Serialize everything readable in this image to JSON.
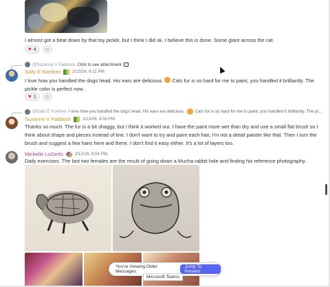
{
  "messages": [
    {
      "text": "I almost got a beat down by that toy pickle, but I think I did ok. I believe this is done. Some glare across the cat.",
      "reactions": [
        {
          "emoji": "heart-icon",
          "count": "4"
        }
      ]
    },
    {
      "reply": {
        "mention": "@Suzanne V Paddock",
        "text": "Click to see attachment"
      },
      "author": "Sally E Koellner",
      "timestamp": "2/13/26, 6:11 PM",
      "text_before_emoji": "I love how you handled the dogs head. His ears are delicious. ",
      "text_after_emoji": " Cats fur is so hard for me to paint, you handled it brilliantly. The pickle color is perfect now.",
      "reactions": [
        {
          "emoji": "heart-icon",
          "count": "1"
        }
      ]
    },
    {
      "reply": {
        "mention": "@Sally E Koellner",
        "text_before_emoji": "I love how you handled the dogs head. His ears are delicious. ",
        "text_after_emoji": " Cats fur is so hard for me to paint, you handled it brilliantly. The pi..."
      },
      "author": "Suzanne V Paddock",
      "timestamp": "2/13/26, 4:50 PM",
      "text": "Thanks so much. The fur is a bit shaggy, but I think it worked out. I have the paint more wet than dry and use a small flat brush so I think about shape and pieces instead of line. I don't want to try and paint each hair, I'm not a detail painter like that. Then I turn the brush and suggest a few hairs here and there. I don't find it easy either. It's a lot of layers too."
    },
    {
      "author": "Michelle LoGerfo",
      "timestamp": "2/13/26, 8:04 PM",
      "text": "Daily exercises. The last two females are the result of going down a Mucha rabbit hole and finding his reference photography."
    }
  ],
  "banner": {
    "text": "You're Viewing Older Messages",
    "button": "Jump To Present",
    "tooltip": "Microsoft Teams"
  },
  "colors": {
    "accent": "#5865f2",
    "heart": "#d8344a",
    "sally": "#d18b2a",
    "suzanne": "#c29a1c",
    "michelle": "#b03c8c"
  }
}
